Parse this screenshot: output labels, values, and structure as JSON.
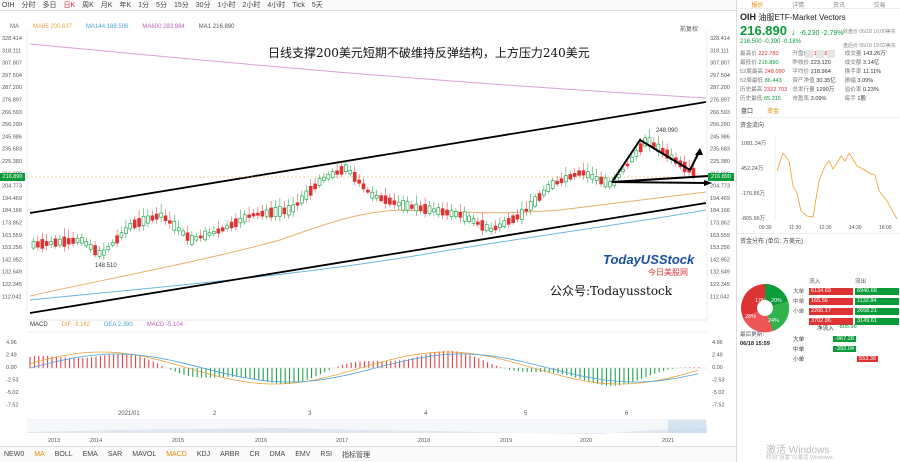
{
  "toolbar": {
    "ticker": "OIH",
    "items": [
      "分时",
      "多日",
      "日K",
      "周K",
      "月K",
      "年K",
      "1分",
      "5分",
      "15分",
      "30分",
      "1小时",
      "2小时",
      "4小时",
      "Tick",
      "5天"
    ],
    "active_index": 2
  },
  "legend": [
    {
      "label": "MA",
      "value": "",
      "color": "#666"
    },
    {
      "label": "MA65",
      "value": "200.637",
      "color": "#e8a33a"
    },
    {
      "label": "MA144",
      "value": "188.506",
      "color": "#4aa3d8"
    },
    {
      "label": "MA600",
      "value": "283.984",
      "color": "#c060c0"
    },
    {
      "label": "MA1",
      "value": "216.890",
      "color": "#555"
    }
  ],
  "corner_label": "前复权",
  "annotation_title": "日线支撑200美元短期不破维持反弹结构，上方压力240美元",
  "brand": {
    "name": "TodayUSStock",
    "sub": "今日美股网",
    "wechat": "公众号:Todayusstock"
  },
  "price_axis": [
    "328.414",
    "318.111",
    "307.807",
    "297.504",
    "287.200",
    "276.897",
    "266.593",
    "256.290",
    "245.986",
    "235.683",
    "225.380",
    "216.890",
    "204.773",
    "194.469",
    "184.166",
    "173.862",
    "163.559",
    "153.256",
    "142.952",
    "132.649",
    "122.345",
    "112.042"
  ],
  "current_price_tag": "216.890",
  "high_label": "248.090",
  "low_label": "148.510",
  "macd_legend": {
    "name": "MACD",
    "dif": "DIF -3.162",
    "dea": "DEA 2.390",
    "macd": "MACD -5.104"
  },
  "macd_axis": [
    "4.96",
    "2.49",
    "0.00",
    "-2.53",
    "-5.02",
    "-7.52"
  ],
  "month_labels": [
    "2021/01",
    "2",
    "3",
    "4",
    "5",
    "6"
  ],
  "year_labels": [
    "2013",
    "2014",
    "2015",
    "2016",
    "2017",
    "2018",
    "2019",
    "2020",
    "2021"
  ],
  "bottom_tabs": [
    "NEW0",
    "MA",
    "BOLL",
    "EMA",
    "SAR",
    "MAVOL",
    "MACD",
    "KDJ",
    "ARBR",
    "CR",
    "DMA",
    "EMV",
    "RSI",
    "指标管理"
  ],
  "bottom_active": [
    1,
    6
  ],
  "right_panel": {
    "tabs": [
      "报价",
      "详情",
      "资讯",
      "交易"
    ],
    "ticker": "OIH",
    "name": "油服ETF-Market Vectors",
    "price": "216.890",
    "change": "-6.230 -2.79%",
    "after_hours": "216.500 -0.390 -0.18%",
    "time1": "收盘价 06/18 16:00美东",
    "time2": "盘后价 06/18 19:02美东",
    "stats": [
      {
        "k": "最高价",
        "v": "222.780",
        "c": "red"
      },
      {
        "k": "开盘价",
        "v": "217.880",
        "c": "red"
      },
      {
        "k": "成交量",
        "v": "143.26万",
        "c": ""
      },
      {
        "k": "最低价",
        "v": "215.890",
        "c": "grn"
      },
      {
        "k": "昨收价",
        "v": "223.120",
        "c": ""
      },
      {
        "k": "成交额",
        "v": "3.14亿",
        "c": ""
      },
      {
        "k": "52周最高",
        "v": "248.090",
        "c": "red"
      },
      {
        "k": "平均价",
        "v": "218.964",
        "c": ""
      },
      {
        "k": "换手率",
        "v": "11.11%",
        "c": ""
      },
      {
        "k": "52周最低",
        "v": "86.443",
        "c": "grn"
      },
      {
        "k": "资产净值",
        "v": "30.35亿",
        "c": ""
      },
      {
        "k": "振幅",
        "v": "3.09%",
        "c": ""
      },
      {
        "k": "历史最高",
        "v": "2322.703",
        "c": "red"
      },
      {
        "k": "总发行量",
        "v": "1290万",
        "c": ""
      },
      {
        "k": "溢价率",
        "v": "0.23%",
        "c": ""
      },
      {
        "k": "历史最低",
        "v": "65.215",
        "c": "grn"
      },
      {
        "k": "市盈率",
        "v": "3.09%",
        "c": ""
      },
      {
        "k": "每手",
        "v": "1股",
        "c": ""
      }
    ],
    "subtabs": [
      "盘口",
      "资金"
    ],
    "flow_title": "资金流向",
    "flow_axis": [
      "1081.34万",
      "452.24万",
      "-176.86万",
      "-805.96万"
    ],
    "flow_time": [
      "09:30",
      "11:30",
      "12:30",
      "14:30",
      "16:00"
    ],
    "dist_title": "资金分布 (单位: 万美元)",
    "pie": {
      "in_label": "流入",
      "out_label": "流出",
      "slices": [
        "17%",
        "20%",
        "24%",
        "28%"
      ]
    },
    "flow_rows": [
      {
        "lbl": "大单",
        "in": "6134.69",
        "out": "6940.66"
      },
      {
        "lbl": "中单",
        "in": "165.56",
        "out": "1132.84"
      },
      {
        "lbl": "小单",
        "in": "2266.17",
        "out": "2658.21"
      },
      {
        "lbl": "",
        "in": "3702.96",
        "out": "3149.61"
      }
    ],
    "net_title": "净流入",
    "net_total": "-805.96",
    "update_label": "最后更新:",
    "update_time": "06/18 15:59",
    "net_rows": [
      {
        "lbl": "大单",
        "v": "-967.28",
        "c": "#0a9b3a"
      },
      {
        "lbl": "中单",
        "v": "-392.04",
        "c": "#0a9b3a"
      },
      {
        "lbl": "小单",
        "v": "553.36",
        "c": "#d33"
      }
    ]
  },
  "watermark": {
    "title": "激活 Windows",
    "sub": "转到\"设置\"以激活 Windows。"
  }
}
